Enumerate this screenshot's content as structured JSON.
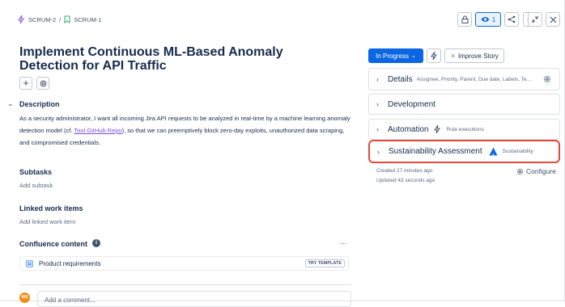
{
  "breadcrumb": {
    "parent": "SCRUM-2",
    "separator": "/",
    "current": "SCRUM-1"
  },
  "toolbar": {
    "watch_count": "1",
    "more_label": "···"
  },
  "issue": {
    "title": "Implement Continuous ML-Based Anomaly Detection for API Traffic"
  },
  "description": {
    "heading": "Description",
    "text_before_link": "As a security administrator, I want all incoming Jira API requests to be analyzed in real-time by a machine learning anomaly detection model (cf. ",
    "link_text": "Tool GitHub Repo",
    "text_after_link": "), so that we can preemptively block zero-day exploits, unauthorized data scraping, and compromised credentials."
  },
  "subtasks": {
    "heading": "Subtasks",
    "add_label": "Add subtask"
  },
  "linked": {
    "heading": "Linked work items",
    "add_label": "Add linked work item"
  },
  "confluence": {
    "heading": "Confluence content",
    "more_label": "···",
    "item_label": "Product requirements",
    "item_badge": "TRY TEMPLATE"
  },
  "comment": {
    "avatar_initials": "MS",
    "placeholder": "Add a comment..."
  },
  "status": {
    "label": "In Progress",
    "improve_label": "Improve Story"
  },
  "panels": {
    "details": {
      "title": "Details",
      "subtitle": "Assignee, Priority, Parent, Due date, Labels, Te..."
    },
    "development": {
      "title": "Development"
    },
    "automation": {
      "title": "Automation",
      "subtitle": "Rule executions"
    },
    "sustainability": {
      "title": "Sustainability Assessment",
      "subtitle": "Sustainability"
    }
  },
  "meta": {
    "created": "Created 27 minutes ago",
    "updated": "Updated 43 seconds ago",
    "configure_label": "Configure"
  },
  "colors": {
    "accent": "#0c66e4",
    "highlight": "#e5493a",
    "link": "#7e4ddb",
    "status_bg": "#0c66e4"
  }
}
